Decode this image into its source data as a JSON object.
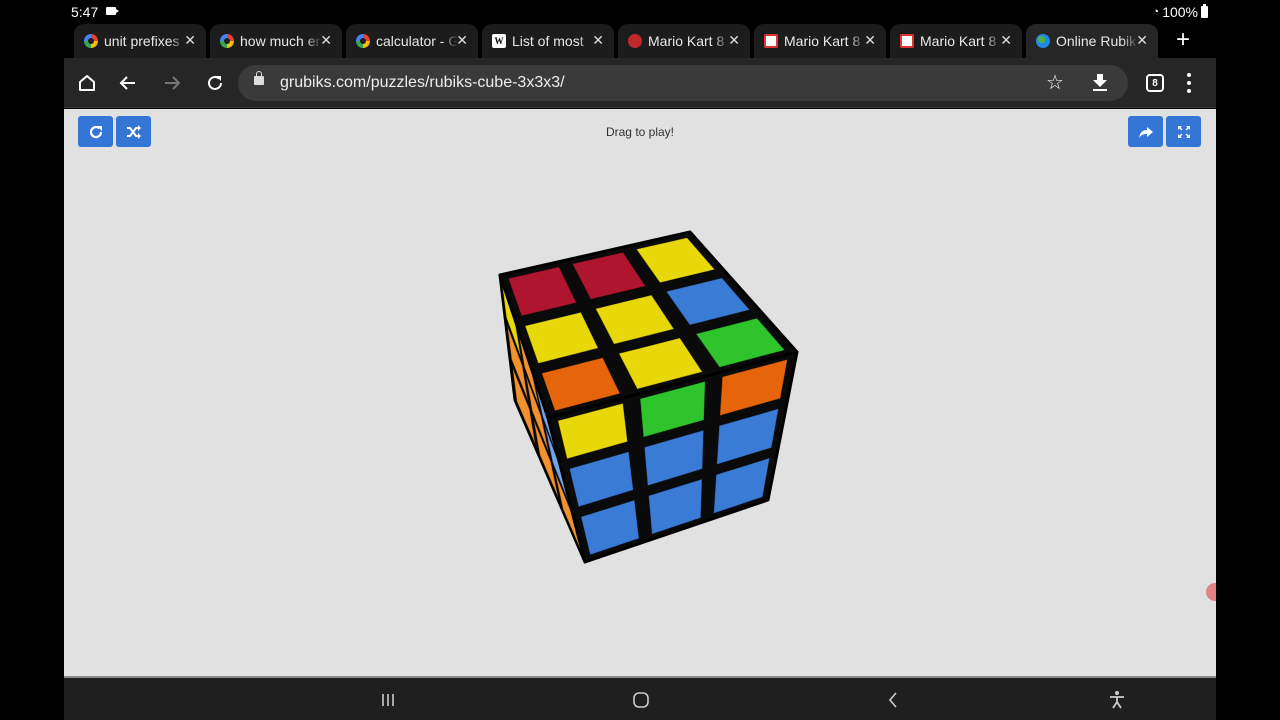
{
  "status_bar": {
    "time": "5:47",
    "battery": "100%"
  },
  "tabs": [
    {
      "title": "unit prefixes",
      "favicon": "google-icon",
      "active": false
    },
    {
      "title": "how much en",
      "favicon": "google-icon",
      "active": false
    },
    {
      "title": "calculator - G",
      "favicon": "google-icon",
      "active": false
    },
    {
      "title": "List of most",
      "favicon": "wikipedia-icon",
      "active": false
    },
    {
      "title": "Mario Kart 8",
      "favicon": "mario-icon",
      "active": false
    },
    {
      "title": "Mario Kart 8",
      "favicon": "mario-kart-icon",
      "active": false
    },
    {
      "title": "Mario Kart 8",
      "favicon": "mario-kart-icon",
      "active": false
    },
    {
      "title": "Online Rubik",
      "favicon": "globe-icon",
      "active": true
    }
  ],
  "toolbar": {
    "url": "grubiks.com/puzzles/rubiks-cube-3x3x3/",
    "tab_count": "8",
    "close_glyph": "✕",
    "new_tab_glyph": "+"
  },
  "page": {
    "hint": "Drag to play!",
    "buttons": {
      "reset": "reset-icon",
      "scramble": "shuffle-icon",
      "share": "share-icon",
      "fullscreen": "fullscreen-icon"
    },
    "accent_color": "#3476d6"
  },
  "cube": {
    "colors": {
      "red": "#b01530",
      "yellow": "#e8d80a",
      "blue": "#3a7bd5",
      "green": "#2fc42c",
      "orange": "#e6650a",
      "light_orange": "#f3912f",
      "light_blue": "#6fa7ef"
    },
    "top_face": [
      [
        "red",
        "red",
        "yellow"
      ],
      [
        "yellow",
        "yellow",
        "blue"
      ],
      [
        "orange",
        "yellow",
        "green"
      ]
    ],
    "front_face": [
      [
        "yellow",
        "green",
        "orange"
      ],
      [
        "blue",
        "blue",
        "blue"
      ],
      [
        "blue",
        "blue",
        "blue"
      ]
    ],
    "left_face": [
      [
        "yellow",
        "light_orange",
        "light_blue"
      ],
      [
        "light_orange",
        "light_orange",
        "light_blue"
      ],
      [
        "light_orange",
        "light_orange",
        "light_orange"
      ]
    ]
  }
}
